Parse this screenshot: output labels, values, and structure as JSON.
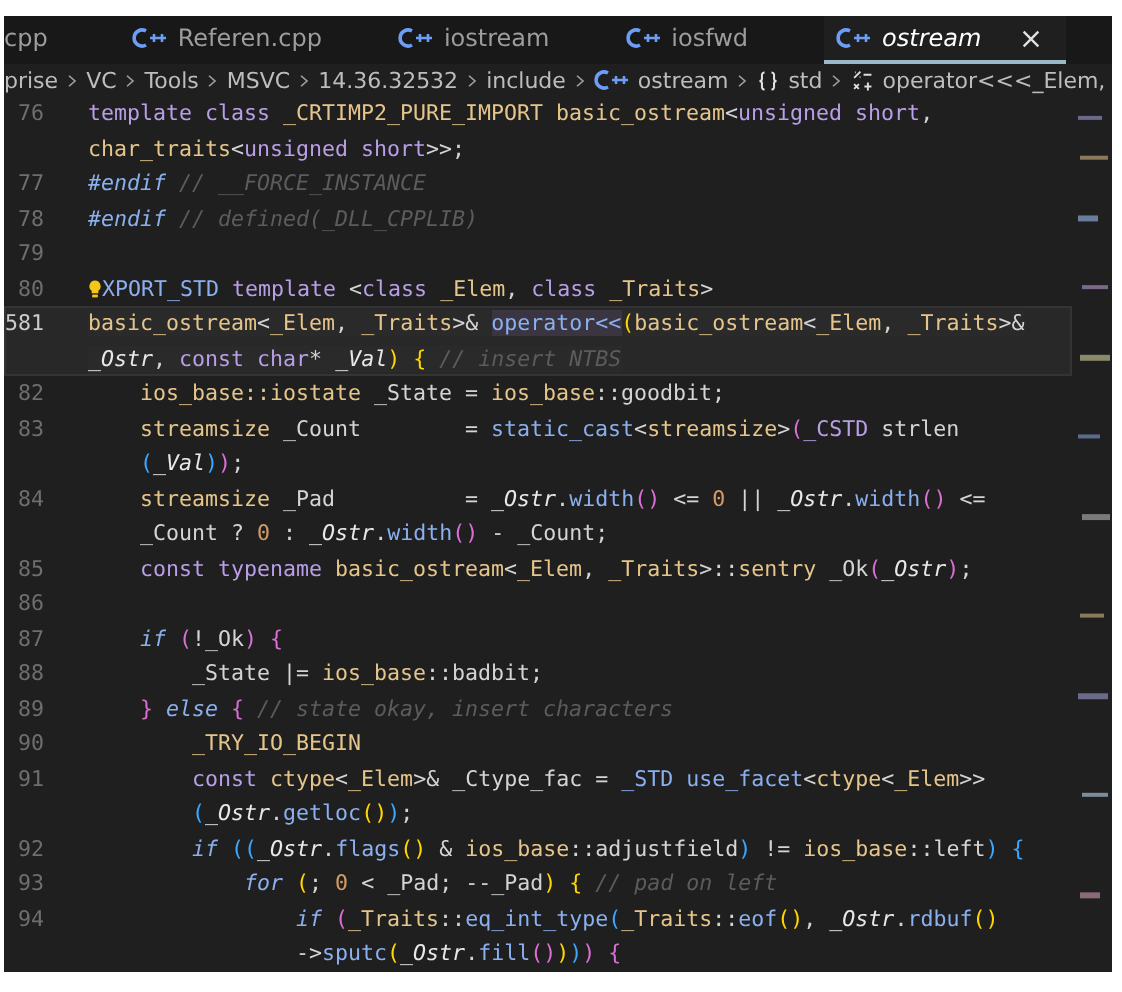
{
  "tabs": [
    {
      "label": "cpp",
      "icon": false,
      "selected": false,
      "close_button": false
    },
    {
      "label": "Referen.cpp",
      "icon": true,
      "selected": false,
      "close_button": false
    },
    {
      "label": "iostream",
      "icon": true,
      "selected": false,
      "close_button": false
    },
    {
      "label": "iosfwd",
      "icon": true,
      "selected": false,
      "close_button": false
    },
    {
      "label": "ostream",
      "icon": true,
      "selected": true,
      "close_button": true
    }
  ],
  "breadcrumbs": [
    {
      "label": "prise",
      "kind": "folder"
    },
    {
      "label": "VC",
      "kind": "folder"
    },
    {
      "label": "Tools",
      "kind": "folder"
    },
    {
      "label": "MSVC",
      "kind": "folder"
    },
    {
      "label": "14.36.32532",
      "kind": "folder"
    },
    {
      "label": "include",
      "kind": "folder"
    },
    {
      "label": "ostream",
      "kind": "file"
    },
    {
      "label": "std",
      "kind": "namespace"
    },
    {
      "label": "operator<<<_Elem,",
      "kind": "operator"
    }
  ],
  "lines": [
    {
      "number": "76",
      "current": false,
      "lightbulb": false,
      "rows": [
        {
          "tokens": [
            {
              "kind": "keyword",
              "text": "template class "
            },
            {
              "kind": "type",
              "text": "_CRTIMP2_PURE_IMPORT basic_ostream"
            },
            {
              "kind": "plain",
              "text": "<"
            },
            {
              "kind": "keyword",
              "text": "unsigned short"
            },
            {
              "kind": "plain",
              "text": ","
            }
          ]
        },
        {
          "tokens": [
            {
              "kind": "type",
              "text": "char_traits"
            },
            {
              "kind": "plain",
              "text": "<"
            },
            {
              "kind": "keyword",
              "text": "unsigned short"
            },
            {
              "kind": "plain",
              "text": ">>;"
            }
          ]
        }
      ]
    },
    {
      "number": "77",
      "current": false,
      "lightbulb": false,
      "rows": [
        {
          "tokens": [
            {
              "kind": "control",
              "text": "#endif"
            },
            {
              "kind": "comment",
              "text": " // __FORCE_INSTANCE"
            }
          ]
        }
      ]
    },
    {
      "number": "78",
      "current": false,
      "lightbulb": false,
      "rows": [
        {
          "tokens": [
            {
              "kind": "control",
              "text": "#endif"
            },
            {
              "kind": "comment",
              "text": " // defined(_DLL_CPPLIB)"
            }
          ]
        }
      ]
    },
    {
      "number": "79",
      "current": false,
      "lightbulb": false
    },
    {
      "number": "80",
      "current": false,
      "lightbulb": true,
      "rows": [
        {
          "tokens": [
            {
              "kind": "function",
              "text": "XPORT_STD"
            },
            {
              "kind": "keyword",
              "text": " template"
            },
            {
              "kind": "plain",
              "text": " <"
            },
            {
              "kind": "keyword",
              "text": "class"
            },
            {
              "kind": "type",
              "text": " _Elem"
            },
            {
              "kind": "plain",
              "text": ", "
            },
            {
              "kind": "keyword",
              "text": "class"
            },
            {
              "kind": "type",
              "text": " _Traits"
            },
            {
              "kind": "plain",
              "text": ">"
            }
          ]
        }
      ]
    },
    {
      "number": "581",
      "current": true,
      "lightbulb": false,
      "rows": [
        {
          "tokens": [
            {
              "kind": "type",
              "text": "basic_ostream"
            },
            {
              "kind": "plain",
              "text": "<"
            },
            {
              "kind": "type",
              "text": "_Elem"
            },
            {
              "kind": "plain",
              "text": ", "
            },
            {
              "kind": "type",
              "text": "_Traits"
            },
            {
              "kind": "plain",
              "text": ">& "
            },
            {
              "kind": "highlight",
              "text": "operator<<"
            },
            {
              "kind": "bracket1",
              "text": "("
            },
            {
              "kind": "type",
              "text": "basic_ostream"
            },
            {
              "kind": "plain",
              "text": "<"
            },
            {
              "kind": "type",
              "text": "_Elem"
            },
            {
              "kind": "plain",
              "text": ", "
            },
            {
              "kind": "type",
              "text": "_Traits"
            },
            {
              "kind": "plain",
              "text": ">&"
            }
          ]
        },
        {
          "tokens": [
            {
              "kind": "variable",
              "text": "_Ostr"
            },
            {
              "kind": "plain",
              "text": ", "
            },
            {
              "kind": "keyword",
              "text": "const char"
            },
            {
              "kind": "plain",
              "text": "* "
            },
            {
              "kind": "variable",
              "text": "_Val"
            },
            {
              "kind": "bracket1",
              "text": ")"
            },
            {
              "kind": "bracket1",
              "text": " {"
            },
            {
              "kind": "comment",
              "text": " // insert NTBS"
            }
          ]
        }
      ]
    },
    {
      "number": "82",
      "current": false,
      "lightbulb": false,
      "rows": [
        {
          "tokens": [
            {
              "kind": "type",
              "text": "    ios_base::iostate"
            },
            {
              "kind": "plain",
              "text": " _State = "
            },
            {
              "kind": "type",
              "text": "ios_base"
            },
            {
              "kind": "plain",
              "text": "::goodbit;"
            }
          ]
        }
      ]
    },
    {
      "number": "83",
      "current": false,
      "lightbulb": false,
      "rows": [
        {
          "tokens": [
            {
              "kind": "type",
              "text": "    streamsize"
            },
            {
              "kind": "plain",
              "text": " _Count        = "
            },
            {
              "kind": "function",
              "text": "static_cast"
            },
            {
              "kind": "plain",
              "text": "<"
            },
            {
              "kind": "type",
              "text": "streamsize"
            },
            {
              "kind": "plain",
              "text": ">"
            },
            {
              "kind": "bracket2",
              "text": "("
            },
            {
              "kind": "keyword",
              "text": "_CSTD"
            },
            {
              "kind": "plain",
              "text": " strlen"
            }
          ]
        },
        {
          "tokens": [
            {
              "kind": "bracket3",
              "text": "    ("
            },
            {
              "kind": "variable",
              "text": "_Val"
            },
            {
              "kind": "bracket3",
              "text": ")"
            },
            {
              "kind": "bracket2",
              "text": ")"
            },
            {
              "kind": "plain",
              "text": ";"
            }
          ]
        }
      ]
    },
    {
      "number": "84",
      "current": false,
      "lightbulb": false,
      "rows": [
        {
          "tokens": [
            {
              "kind": "type",
              "text": "    streamsize"
            },
            {
              "kind": "plain",
              "text": " _Pad          = "
            },
            {
              "kind": "variable",
              "text": "_Ostr"
            },
            {
              "kind": "plain",
              "text": "."
            },
            {
              "kind": "function",
              "text": "width"
            },
            {
              "kind": "bracket2",
              "text": "()"
            },
            {
              "kind": "plain",
              "text": " <= "
            },
            {
              "kind": "number",
              "text": "0"
            },
            {
              "kind": "plain",
              "text": " || "
            },
            {
              "kind": "variable",
              "text": "_Ostr"
            },
            {
              "kind": "plain",
              "text": "."
            },
            {
              "kind": "function",
              "text": "width"
            },
            {
              "kind": "bracket2",
              "text": "()"
            },
            {
              "kind": "plain",
              "text": " <="
            }
          ]
        },
        {
          "tokens": [
            {
              "kind": "plain",
              "text": "    _Count ? "
            },
            {
              "kind": "number",
              "text": "0"
            },
            {
              "kind": "plain",
              "text": " : "
            },
            {
              "kind": "variable",
              "text": "_Ostr"
            },
            {
              "kind": "plain",
              "text": "."
            },
            {
              "kind": "function",
              "text": "width"
            },
            {
              "kind": "bracket2",
              "text": "()"
            },
            {
              "kind": "plain",
              "text": " - _Count;"
            }
          ]
        }
      ]
    },
    {
      "number": "85",
      "current": false,
      "lightbulb": false,
      "rows": [
        {
          "tokens": [
            {
              "kind": "keyword",
              "text": "    const typename"
            },
            {
              "kind": "type",
              "text": " basic_ostream"
            },
            {
              "kind": "plain",
              "text": "<"
            },
            {
              "kind": "type",
              "text": "_Elem"
            },
            {
              "kind": "plain",
              "text": ", "
            },
            {
              "kind": "type",
              "text": "_Traits"
            },
            {
              "kind": "plain",
              "text": ">::"
            },
            {
              "kind": "type",
              "text": "sentry"
            },
            {
              "kind": "plain",
              "text": " _Ok"
            },
            {
              "kind": "bracket2",
              "text": "("
            },
            {
              "kind": "variable",
              "text": "_Ostr"
            },
            {
              "kind": "bracket2",
              "text": ")"
            },
            {
              "kind": "plain",
              "text": ";"
            }
          ]
        }
      ]
    },
    {
      "number": "86",
      "current": false,
      "lightbulb": false
    },
    {
      "number": "87",
      "current": false,
      "lightbulb": false,
      "rows": [
        {
          "tokens": [
            {
              "kind": "control",
              "text": "    if"
            },
            {
              "kind": "bracket2",
              "text": " ("
            },
            {
              "kind": "plain",
              "text": "!_Ok"
            },
            {
              "kind": "bracket2",
              "text": ") {"
            }
          ]
        }
      ]
    },
    {
      "number": "88",
      "current": false,
      "lightbulb": false,
      "rows": [
        {
          "tokens": [
            {
              "kind": "plain",
              "text": "        _State |= "
            },
            {
              "kind": "type",
              "text": "ios_base"
            },
            {
              "kind": "plain",
              "text": "::badbit;"
            }
          ]
        }
      ]
    },
    {
      "number": "89",
      "current": false,
      "lightbulb": false,
      "rows": [
        {
          "tokens": [
            {
              "kind": "bracket2",
              "text": "    } "
            },
            {
              "kind": "control",
              "text": "else"
            },
            {
              "kind": "bracket2",
              "text": " {"
            },
            {
              "kind": "comment",
              "text": " // state okay, insert characters"
            }
          ]
        }
      ]
    },
    {
      "number": "90",
      "current": false,
      "lightbulb": false,
      "rows": [
        {
          "tokens": [
            {
              "kind": "type",
              "text": "        _TRY_IO_BEGIN"
            }
          ]
        }
      ]
    },
    {
      "number": "91",
      "current": false,
      "lightbulb": false,
      "rows": [
        {
          "tokens": [
            {
              "kind": "keyword",
              "text": "        const"
            },
            {
              "kind": "type",
              "text": " ctype"
            },
            {
              "kind": "plain",
              "text": "<"
            },
            {
              "kind": "type",
              "text": "_Elem"
            },
            {
              "kind": "plain",
              "text": ">& _Ctype_fac = "
            },
            {
              "kind": "function",
              "text": "_STD use_facet"
            },
            {
              "kind": "plain",
              "text": "<"
            },
            {
              "kind": "type",
              "text": "ctype"
            },
            {
              "kind": "plain",
              "text": "<"
            },
            {
              "kind": "type",
              "text": "_Elem"
            },
            {
              "kind": "plain",
              "text": ">>"
            }
          ]
        },
        {
          "tokens": [
            {
              "kind": "bracket3",
              "text": "        ("
            },
            {
              "kind": "variable",
              "text": "_Ostr"
            },
            {
              "kind": "plain",
              "text": "."
            },
            {
              "kind": "function",
              "text": "getloc"
            },
            {
              "kind": "bracket1",
              "text": "()"
            },
            {
              "kind": "bracket3",
              "text": ")"
            },
            {
              "kind": "plain",
              "text": ";"
            }
          ]
        }
      ]
    },
    {
      "number": "92",
      "current": false,
      "lightbulb": false,
      "rows": [
        {
          "tokens": [
            {
              "kind": "control",
              "text": "        if"
            },
            {
              "kind": "bracket3",
              "text": " (("
            },
            {
              "kind": "variable",
              "text": "_Ostr"
            },
            {
              "kind": "plain",
              "text": "."
            },
            {
              "kind": "function",
              "text": "flags"
            },
            {
              "kind": "bracket1",
              "text": "()"
            },
            {
              "kind": "plain",
              "text": " & "
            },
            {
              "kind": "type",
              "text": "ios_base"
            },
            {
              "kind": "plain",
              "text": "::adjustfield"
            },
            {
              "kind": "bracket3",
              "text": ")"
            },
            {
              "kind": "plain",
              "text": " != "
            },
            {
              "kind": "type",
              "text": "ios_base"
            },
            {
              "kind": "plain",
              "text": "::left"
            },
            {
              "kind": "bracket3",
              "text": ") {"
            }
          ]
        }
      ]
    },
    {
      "number": "93",
      "current": false,
      "lightbulb": false,
      "rows": [
        {
          "tokens": [
            {
              "kind": "control",
              "text": "            for"
            },
            {
              "kind": "bracket1",
              "text": " ("
            },
            {
              "kind": "plain",
              "text": "; "
            },
            {
              "kind": "number",
              "text": "0"
            },
            {
              "kind": "plain",
              "text": " < _Pad; --_Pad"
            },
            {
              "kind": "bracket1",
              "text": ") {"
            },
            {
              "kind": "comment",
              "text": " // pad on left"
            }
          ]
        }
      ]
    },
    {
      "number": "94",
      "current": false,
      "lightbulb": false,
      "rows": [
        {
          "tokens": [
            {
              "kind": "control",
              "text": "                if"
            },
            {
              "kind": "bracket2",
              "text": " ("
            },
            {
              "kind": "type",
              "text": "_Traits"
            },
            {
              "kind": "plain",
              "text": "::"
            },
            {
              "kind": "function",
              "text": "eq_int_type"
            },
            {
              "kind": "bracket3",
              "text": "("
            },
            {
              "kind": "type",
              "text": "_Traits"
            },
            {
              "kind": "plain",
              "text": "::"
            },
            {
              "kind": "function",
              "text": "eof"
            },
            {
              "kind": "bracket1",
              "text": "()"
            },
            {
              "kind": "plain",
              "text": ", "
            },
            {
              "kind": "variable",
              "text": "_Ostr"
            },
            {
              "kind": "plain",
              "text": "."
            },
            {
              "kind": "function",
              "text": "rdbuf"
            },
            {
              "kind": "bracket1",
              "text": "()"
            }
          ]
        },
        {
          "tokens": [
            {
              "kind": "plain",
              "text": "                ->"
            },
            {
              "kind": "function",
              "text": "sputc"
            },
            {
              "kind": "bracket1",
              "text": "("
            },
            {
              "kind": "variable",
              "text": "_Ostr"
            },
            {
              "kind": "plain",
              "text": "."
            },
            {
              "kind": "function",
              "text": "fill"
            },
            {
              "kind": "bracket2",
              "text": "()"
            },
            {
              "kind": "bracket1",
              "text": ")"
            },
            {
              "kind": "bracket3",
              "text": ")"
            },
            {
              "kind": "bracket2",
              "text": ") {"
            }
          ]
        }
      ]
    }
  ]
}
